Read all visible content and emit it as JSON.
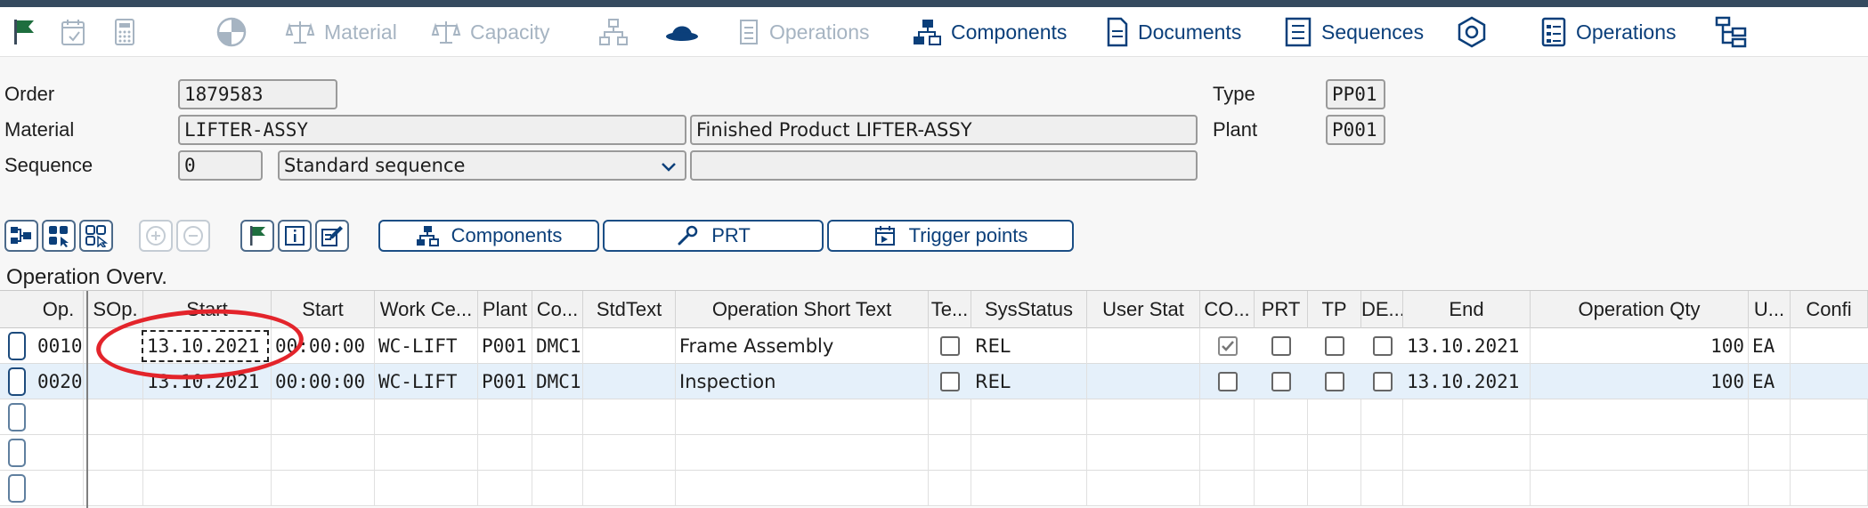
{
  "toolbar": {
    "material_label": "Material",
    "capacity_label": "Capacity",
    "operations_disabled_label": "Operations",
    "components_label": "Components",
    "documents_label": "Documents",
    "sequences_label": "Sequences",
    "operations_label": "Operations"
  },
  "header": {
    "order_label": "Order",
    "order_value": "1879583",
    "material_label": "Material",
    "material_value": "LIFTER-ASSY",
    "material_desc": "Finished Product LIFTER-ASSY",
    "sequence_label": "Sequence",
    "sequence_value": "0",
    "sequence_type": "Standard sequence",
    "sequence_extra": "",
    "type_label": "Type",
    "type_value": "PP01",
    "plant_label": "Plant",
    "plant_value": "P001"
  },
  "action_buttons": {
    "components": "Components",
    "prt": "PRT",
    "trigger_points": "Trigger points"
  },
  "section": {
    "title": "Operation Overv."
  },
  "table": {
    "columns": [
      "Op.",
      "SOp.",
      "Start",
      "Start",
      "Work Ce...",
      "Plant",
      "Co...",
      "StdText",
      "Operation Short Text",
      "Te...",
      "SysStatus",
      "User Stat",
      "CO...",
      "PRT",
      "TP",
      "DE...",
      "End",
      "Operation Qty",
      "U...",
      "Confi"
    ],
    "rows": [
      {
        "op": "0010",
        "sop": "",
        "start_date": "13.10.2021",
        "start_time": "00:00:00",
        "work_center": "WC-LIFT",
        "plant": "P001",
        "control": "DMC1",
        "stdtext": "",
        "short_text": "Frame Assembly",
        "te": false,
        "sys_status": "REL",
        "user_status": "",
        "co": true,
        "prt": false,
        "tp": false,
        "de": false,
        "end": "13.10.2021",
        "qty": "100",
        "unit": "EA"
      },
      {
        "op": "0020",
        "sop": "",
        "start_date": "13.10.2021",
        "start_time": "00:00:00",
        "work_center": "WC-LIFT",
        "plant": "P001",
        "control": "DMC1",
        "stdtext": "",
        "short_text": "Inspection",
        "te": false,
        "sys_status": "REL",
        "user_status": "",
        "co": false,
        "prt": false,
        "tp": false,
        "de": false,
        "end": "13.10.2021",
        "qty": "100",
        "unit": "EA"
      }
    ]
  },
  "colors": {
    "accent": "#0b3f7a",
    "disabled": "#a6b4c2",
    "annotation": "#e3242b",
    "selected_row": "#e5f0fa"
  },
  "icons": [
    "flag-icon",
    "calendar-icon",
    "calculator-icon",
    "pie-chart-icon",
    "scales-icon",
    "network-icon",
    "hat-icon",
    "operations-icon",
    "components-icon",
    "document-icon",
    "sequences-icon",
    "gear-cube-icon",
    "operations-list-icon",
    "tree-icon"
  ]
}
